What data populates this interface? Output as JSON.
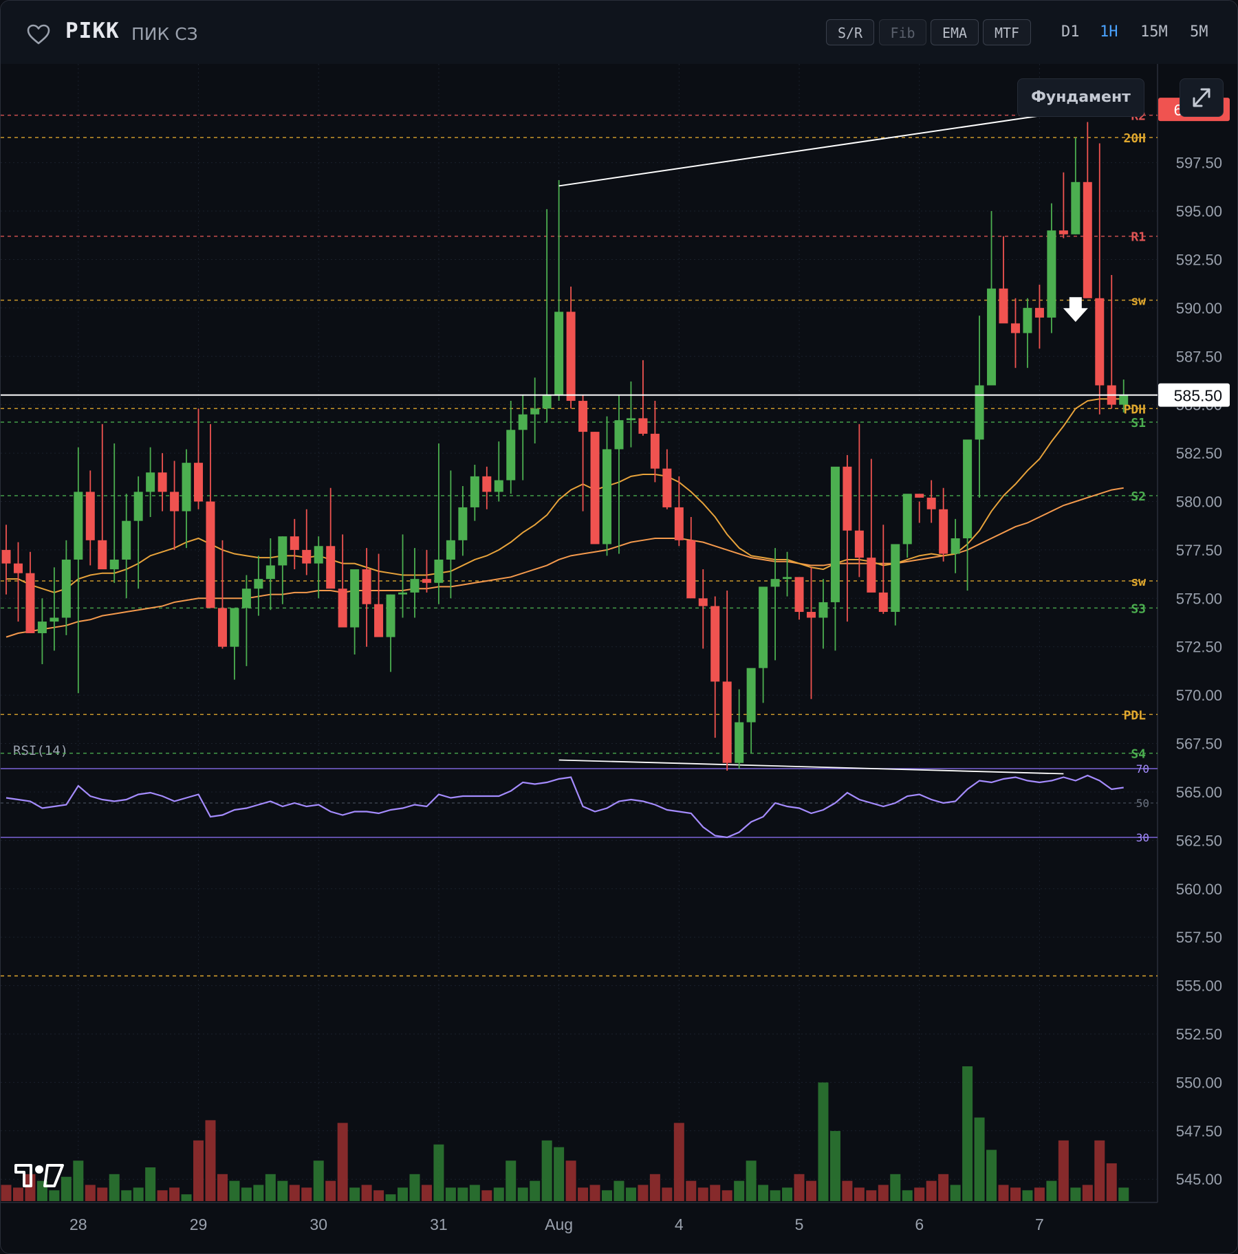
{
  "header": {
    "ticker": "PIKK",
    "company": "ПИК СЗ",
    "toolbar": [
      {
        "label": "S/R",
        "enabled": true
      },
      {
        "label": "Fib",
        "enabled": false
      },
      {
        "label": "EMA",
        "enabled": true
      },
      {
        "label": "MTF",
        "enabled": true
      }
    ],
    "timeframes": [
      "D1",
      "1H",
      "15M",
      "5M"
    ],
    "active_timeframe": "1H",
    "fundament_label": "Фундамент"
  },
  "colors": {
    "up": "#4caf50",
    "down": "#f05350",
    "ema_fast": "#e8a33b",
    "ema_slow": "#f59a4d",
    "rsi": "#a58cff",
    "level_resist": "#e05555",
    "level_support": "#4caf50",
    "level_key": "#e0a82e"
  },
  "chart_data": {
    "type": "candlestick",
    "symbol": "PIKK",
    "timeframe": "1H",
    "y_axis": {
      "ticks": [
        "565.00",
        "567.50",
        "570.00",
        "572.50",
        "575.00",
        "577.50",
        "580.00",
        "582.50",
        "585.00",
        "587.50",
        "590.00",
        "592.50",
        "595.00",
        "597.50",
        "600.00",
        "545.00",
        "547.50",
        "550.00",
        "552.50",
        "555.00",
        "557.50",
        "560.00",
        "562.50"
      ],
      "tick_values": [
        565,
        567.5,
        570,
        572.5,
        575,
        577.5,
        580,
        582.5,
        585,
        587.5,
        590,
        592.5,
        595,
        597.5,
        600,
        545,
        547.5,
        550,
        552.5,
        555,
        557.5,
        560,
        562.5
      ],
      "range": [
        543.8,
        602.6
      ]
    },
    "x_axis": {
      "labels": [
        "28",
        "29",
        "30",
        "31",
        "Aug",
        "4",
        "5",
        "6",
        "7"
      ],
      "label_bar_index": [
        6,
        16,
        26,
        36,
        46,
        56,
        66,
        76,
        86
      ]
    },
    "last_price": "585.50",
    "last_price_value": 585.5,
    "high_price_tag": "600.25",
    "high_price_value": 600.25,
    "levels": [
      {
        "label": "R2",
        "value": 599.95,
        "kind": "resist"
      },
      {
        "label": "20H",
        "value": 598.8,
        "kind": "key"
      },
      {
        "label": "R1",
        "value": 593.7,
        "kind": "resist"
      },
      {
        "label": "sw",
        "value": 590.4,
        "kind": "key"
      },
      {
        "label": "PDH",
        "value": 584.8,
        "kind": "key"
      },
      {
        "label": "S1",
        "value": 584.1,
        "kind": "support"
      },
      {
        "label": "S2",
        "value": 580.3,
        "kind": "support"
      },
      {
        "label": "sw",
        "value": 575.9,
        "kind": "key"
      },
      {
        "label": "S3",
        "value": 574.5,
        "kind": "support"
      },
      {
        "label": "PDL",
        "value": 569.0,
        "kind": "key"
      },
      {
        "label": "S4",
        "value": 567.0,
        "kind": "support"
      }
    ],
    "candles": {
      "open": [
        577.5,
        576.8,
        576.3,
        573.2,
        573.8,
        574.0,
        577.0,
        580.5,
        578.0,
        576.5,
        577.0,
        579.0,
        580.5,
        581.5,
        580.5,
        579.5,
        582.0,
        580.0,
        574.5,
        572.5,
        574.5,
        575.5,
        576.0,
        576.7,
        578.2,
        577.5,
        576.8,
        577.7,
        575.5,
        573.5,
        576.5,
        574.7,
        573.0,
        575.2,
        575.3,
        576.0,
        575.8,
        577.0,
        578.0,
        579.7,
        581.3,
        580.5,
        581.1,
        583.7,
        584.5,
        584.8,
        585.5,
        589.8,
        585.2,
        583.6,
        577.8,
        582.7,
        584.2,
        584.3,
        583.5,
        581.7,
        579.7,
        578.0,
        575.0,
        574.6,
        570.7,
        566.5,
        568.6,
        571.4,
        575.6,
        576.0,
        576.1,
        574.3,
        574.0,
        574.8,
        581.8,
        578.5,
        577.1,
        575.3,
        574.3,
        577.8,
        580.4,
        580.2,
        579.6,
        577.3,
        578.1,
        583.2,
        586.0,
        591.0,
        589.2,
        588.7,
        590.0,
        589.5,
        594.0,
        593.8,
        596.5,
        590.5,
        586.0,
        585.0
      ],
      "high": [
        578.8,
        577.9,
        577.4,
        575.0,
        576.6,
        578.0,
        582.8,
        581.6,
        584.0,
        583.0,
        580.4,
        581.3,
        582.8,
        582.5,
        582.1,
        582.7,
        584.8,
        584.0,
        578.0,
        573.6,
        576.2,
        577.2,
        578.1,
        578.2,
        579.1,
        579.6,
        578.2,
        580.7,
        578.3,
        576.0,
        577.6,
        577.3,
        575.2,
        578.3,
        577.6,
        577.5,
        583.0,
        581.6,
        580.8,
        581.9,
        581.8,
        583.1,
        585.2,
        585.5,
        586.4,
        595.1,
        596.6,
        591.1,
        585.5,
        583.6,
        584.4,
        585.5,
        586.2,
        587.3,
        585.2,
        582.7,
        581.3,
        579.2,
        576.5,
        575.1,
        575.4,
        570.3,
        570.1,
        573.1,
        577.6,
        577.4,
        576.0,
        576.6,
        576.0,
        575.3,
        582.4,
        584.0,
        582.2,
        578.8,
        576.6,
        578.9,
        580.0,
        581.1,
        580.7,
        579.1,
        579.8,
        589.6,
        595.0,
        593.7,
        590.5,
        590.5,
        591.2,
        595.4,
        597.0,
        598.8,
        599.6,
        598.5,
        591.7,
        586.3
      ],
      "low": [
        575.2,
        573.8,
        573.5,
        571.6,
        572.3,
        573.1,
        570.1,
        576.7,
        577.7,
        575.8,
        575.0,
        575.5,
        579.2,
        579.5,
        577.5,
        577.6,
        579.6,
        578.4,
        572.4,
        570.8,
        571.5,
        574.1,
        574.4,
        574.7,
        576.5,
        576.2,
        575.0,
        576.3,
        575.5,
        572.1,
        572.5,
        573.2,
        571.2,
        574.0,
        574.0,
        575.3,
        574.7,
        575.0,
        577.2,
        579.0,
        579.6,
        580.0,
        580.4,
        581.1,
        583.0,
        584.1,
        585.2,
        584.8,
        579.5,
        578.1,
        577.2,
        577.3,
        582.8,
        583.4,
        581.0,
        579.6,
        577.7,
        576.0,
        572.4,
        567.8,
        566.1,
        566.2,
        567.0,
        569.6,
        571.8,
        575.1,
        573.9,
        569.8,
        572.4,
        572.3,
        573.8,
        576.1,
        575.8,
        574.2,
        573.6,
        577.1,
        578.9,
        578.9,
        576.9,
        576.3,
        575.4,
        580.2,
        587.5,
        589.5,
        586.9,
        586.9,
        587.9,
        588.7,
        593.6,
        593.8,
        596.3,
        584.5,
        584.8,
        584.6
      ],
      "close": [
        576.8,
        576.3,
        573.2,
        573.8,
        574.0,
        577.0,
        580.5,
        578.0,
        576.5,
        577.0,
        579.0,
        580.5,
        581.5,
        580.5,
        579.5,
        582.0,
        580.0,
        574.5,
        572.5,
        574.5,
        575.5,
        576.0,
        576.7,
        578.2,
        577.5,
        576.8,
        577.7,
        575.5,
        573.5,
        576.5,
        574.7,
        573.0,
        575.2,
        575.3,
        576.0,
        575.8,
        577.0,
        578.0,
        579.7,
        581.3,
        580.5,
        581.1,
        583.7,
        584.5,
        584.8,
        585.5,
        589.8,
        585.2,
        583.6,
        577.8,
        582.7,
        584.2,
        584.3,
        583.5,
        581.7,
        579.7,
        578.0,
        575.0,
        574.6,
        570.7,
        566.5,
        568.6,
        571.4,
        575.6,
        576.0,
        576.1,
        574.3,
        574.0,
        574.8,
        581.8,
        578.5,
        577.1,
        575.3,
        574.3,
        577.8,
        580.4,
        580.2,
        579.6,
        577.3,
        578.1,
        583.2,
        586.0,
        591.0,
        589.2,
        588.7,
        590.0,
        589.5,
        594.0,
        593.8,
        596.5,
        590.5,
        586.0,
        585.0,
        585.5
      ]
    },
    "ema_fast": [
      576.0,
      576.0,
      575.7,
      575.5,
      575.3,
      575.5,
      576.0,
      576.2,
      576.3,
      576.3,
      576.5,
      576.8,
      577.2,
      577.4,
      577.6,
      577.9,
      578.1,
      577.8,
      577.5,
      577.3,
      577.2,
      577.1,
      577.1,
      577.2,
      577.2,
      577.1,
      577.2,
      577.0,
      576.8,
      576.8,
      576.6,
      576.4,
      576.3,
      576.2,
      576.2,
      576.2,
      576.3,
      576.4,
      576.7,
      577.0,
      577.2,
      577.5,
      577.9,
      578.4,
      578.8,
      579.3,
      580.1,
      580.6,
      580.9,
      580.6,
      580.8,
      581.0,
      581.3,
      581.4,
      581.4,
      581.3,
      581.0,
      580.5,
      579.9,
      579.2,
      578.3,
      577.6,
      577.2,
      577.1,
      577.0,
      577.0,
      576.8,
      576.6,
      576.5,
      576.8,
      577.0,
      577.0,
      576.9,
      576.7,
      576.8,
      577.0,
      577.2,
      577.3,
      577.2,
      577.3,
      577.8,
      578.5,
      579.5,
      580.3,
      580.9,
      581.6,
      582.2,
      583.1,
      583.9,
      584.8,
      585.2,
      585.3,
      585.3,
      585.3
    ],
    "ema_slow": [
      573.0,
      573.2,
      573.3,
      573.4,
      573.5,
      573.6,
      573.8,
      573.9,
      574.1,
      574.2,
      574.3,
      574.4,
      574.5,
      574.6,
      574.8,
      574.9,
      575.0,
      575.0,
      575.0,
      575.0,
      575.0,
      575.1,
      575.2,
      575.2,
      575.3,
      575.3,
      575.4,
      575.4,
      575.3,
      575.4,
      575.4,
      575.4,
      575.4,
      575.4,
      575.5,
      575.5,
      575.6,
      575.6,
      575.7,
      575.8,
      575.9,
      576.0,
      576.1,
      576.3,
      576.5,
      576.7,
      577.0,
      577.2,
      577.3,
      577.4,
      577.5,
      577.7,
      577.9,
      578.0,
      578.1,
      578.1,
      578.1,
      578.0,
      577.9,
      577.7,
      577.5,
      577.3,
      577.1,
      577.0,
      576.9,
      576.9,
      576.8,
      576.7,
      576.7,
      576.8,
      576.8,
      576.8,
      576.8,
      576.8,
      576.8,
      576.9,
      577.0,
      577.1,
      577.2,
      577.3,
      577.5,
      577.8,
      578.1,
      578.4,
      578.7,
      578.9,
      579.2,
      579.5,
      579.8,
      580.0,
      580.2,
      580.4,
      580.6,
      580.7
    ],
    "volume": [
      0.12,
      0.1,
      0.2,
      0.15,
      0.08,
      0.18,
      0.3,
      0.12,
      0.1,
      0.2,
      0.08,
      0.1,
      0.25,
      0.08,
      0.1,
      0.05,
      0.45,
      0.6,
      0.2,
      0.15,
      0.1,
      0.12,
      0.2,
      0.15,
      0.12,
      0.1,
      0.3,
      0.15,
      0.58,
      0.1,
      0.12,
      0.08,
      0.05,
      0.1,
      0.2,
      0.12,
      0.42,
      0.1,
      0.1,
      0.12,
      0.08,
      0.1,
      0.3,
      0.1,
      0.15,
      0.45,
      0.4,
      0.3,
      0.1,
      0.12,
      0.08,
      0.15,
      0.1,
      0.12,
      0.2,
      0.1,
      0.58,
      0.15,
      0.1,
      0.12,
      0.08,
      0.15,
      0.3,
      0.12,
      0.08,
      0.1,
      0.2,
      0.15,
      0.88,
      0.52,
      0.15,
      0.1,
      0.08,
      0.12,
      0.2,
      0.08,
      0.1,
      0.15,
      0.2,
      0.12,
      1.0,
      0.62,
      0.38,
      0.12,
      0.1,
      0.08,
      0.1,
      0.15,
      0.45,
      0.1,
      0.12,
      0.45,
      0.28,
      0.1
    ],
    "trendlines": [
      {
        "from_bar": 46,
        "from_value": 596.3,
        "to_bar": 88,
        "to_value": 600.1
      }
    ],
    "arrow_marker": {
      "bar": 89,
      "value": 590.2,
      "direction": "down"
    },
    "rsi": {
      "label": "RSI(14)",
      "levels": [
        {
          "label": "70",
          "value": 70
        },
        {
          "label": "50",
          "value": 50
        },
        {
          "label": "30",
          "value": 30
        }
      ],
      "values": [
        53,
        52,
        51,
        47,
        48,
        49,
        60,
        54,
        52,
        51,
        52,
        55,
        56,
        54,
        51,
        53,
        55,
        42,
        43,
        46,
        47,
        49,
        51,
        48,
        50,
        48,
        49,
        45,
        43,
        45,
        45,
        44,
        46,
        47,
        49,
        48,
        55,
        53,
        54,
        54,
        54,
        54,
        57,
        62,
        61,
        62,
        64,
        65,
        48,
        45,
        47,
        51,
        52,
        51,
        49,
        46,
        45,
        44,
        36,
        31,
        30,
        33,
        39,
        42,
        50,
        48,
        47,
        44,
        46,
        50,
        56,
        52,
        50,
        48,
        50,
        54,
        55,
        52,
        50,
        51,
        58,
        63,
        62,
        64,
        65,
        63,
        62,
        63,
        65,
        63,
        66,
        63,
        58,
        59
      ],
      "divergence": {
        "from_bar": 46,
        "from_rsi": 75,
        "to_bar": 88,
        "to_rsi": 67
      }
    }
  }
}
